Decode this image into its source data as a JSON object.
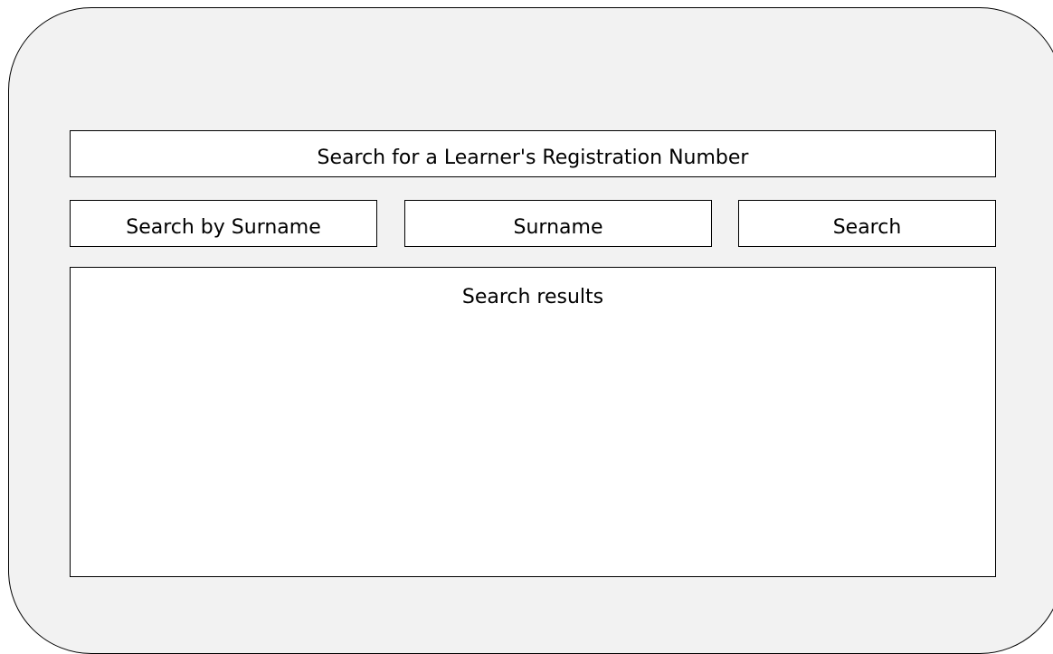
{
  "header": {
    "title": "Search for a Learner's Registration Number"
  },
  "search": {
    "mode_label": "Search by Surname",
    "surname_value": "Surname",
    "button_label": "Search"
  },
  "results": {
    "heading": "Search results"
  }
}
